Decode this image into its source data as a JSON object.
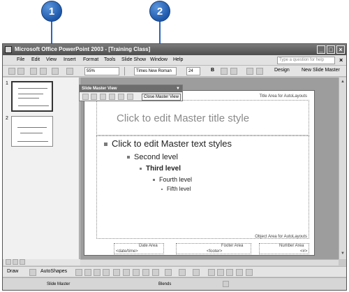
{
  "callouts": [
    "1",
    "2"
  ],
  "window": {
    "title": "Microsoft Office PowerPoint 2003 - [Training Class]",
    "buttons": [
      "_",
      "□",
      "×"
    ]
  },
  "menu": {
    "items": [
      "File",
      "Edit",
      "View",
      "Insert",
      "Format",
      "Tools",
      "Slide Show",
      "Window",
      "Help"
    ],
    "help_placeholder": "Type a question for help",
    "close": "×"
  },
  "toolbar": {
    "zoom": "55%",
    "font": "Times New Roman",
    "size": "24",
    "bold": "B",
    "design": "Design",
    "new_slide": "New Slide Master"
  },
  "slide_pane": {
    "thumbs": [
      "1",
      "2"
    ]
  },
  "master_toolbar": {
    "title": "Slide Master View",
    "close_label": "Close Master View"
  },
  "slide": {
    "title_area_label": "Title Area for AutoLayouts",
    "title_text": "Click to edit Master title style",
    "levels": [
      "Click to edit Master text styles",
      "Second level",
      "Third level",
      "Fourth level",
      "Fifth level"
    ],
    "object_area_label": "Object Area for AutoLayouts",
    "date_area": "Date Area",
    "date_field": "<date/time>",
    "footer_area": "Footer Area",
    "footer_field": "<footer>",
    "number_area": "Number Area",
    "number_field": "<#>"
  },
  "drawing_toolbar": {
    "draw": "Draw",
    "autoshapes": "AutoShapes"
  },
  "status": {
    "view": "Slide Master",
    "design": "Blends"
  },
  "colors": {
    "callout": "#2a65b8",
    "titlebar": "#555555"
  }
}
